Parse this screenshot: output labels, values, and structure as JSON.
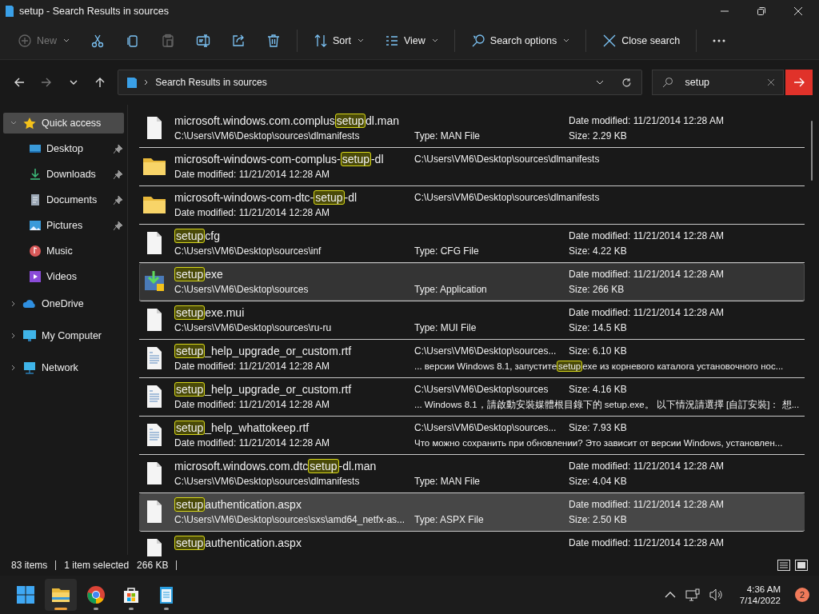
{
  "window": {
    "title": "setup - Search Results in sources"
  },
  "command_bar": [
    {
      "kind": "new",
      "label": "New",
      "disabled": true,
      "dropdown": true
    },
    {
      "kind": "cut",
      "disabled": false,
      "dropdown": false
    },
    {
      "kind": "copy",
      "disabled": false,
      "dropdown": false
    },
    {
      "kind": "paste",
      "disabled": true,
      "dropdown": false
    },
    {
      "kind": "rename",
      "disabled": false,
      "dropdown": false
    },
    {
      "kind": "share",
      "disabled": false,
      "dropdown": false
    },
    {
      "kind": "delete",
      "disabled": false,
      "dropdown": false
    },
    {
      "kind": "sort",
      "label": "Sort",
      "disabled": false,
      "dropdown": true
    },
    {
      "kind": "view",
      "label": "View",
      "disabled": false,
      "dropdown": true
    },
    {
      "kind": "search-options",
      "label": "Search options",
      "disabled": false,
      "dropdown": true
    },
    {
      "kind": "close-search",
      "label": "Close search",
      "disabled": false,
      "dropdown": false
    },
    {
      "kind": "more",
      "disabled": false,
      "dropdown": false
    }
  ],
  "nav_buttons": [
    {
      "kind": "back",
      "disabled": false
    },
    {
      "kind": "forward",
      "disabled": true
    },
    {
      "kind": "recent",
      "disabled": false
    },
    {
      "kind": "up",
      "disabled": false
    }
  ],
  "address": {
    "path": "Search Results in sources"
  },
  "search": {
    "value": "setup"
  },
  "sidebar": {
    "items": [
      {
        "label": "Quick access",
        "kind": "star",
        "expanded": true,
        "selected": true,
        "children": [
          {
            "label": "Desktop",
            "kind": "desktop",
            "pinned": true,
            "selected": false
          },
          {
            "label": "Downloads",
            "kind": "downloads",
            "pinned": true,
            "selected": false
          },
          {
            "label": "Documents",
            "kind": "documents",
            "pinned": true,
            "selected": false
          },
          {
            "label": "Pictures",
            "kind": "pictures",
            "pinned": true,
            "selected": false
          },
          {
            "label": "Music",
            "kind": "music",
            "pinned": false,
            "selected": false
          },
          {
            "label": "Videos",
            "kind": "videos",
            "pinned": false,
            "selected": false
          }
        ]
      },
      {
        "label": "OneDrive",
        "kind": "cloud",
        "expanded": false,
        "selected": false
      },
      {
        "label": "My Computer",
        "kind": "computer",
        "expanded": false,
        "selected": false
      },
      {
        "label": "Network",
        "kind": "network",
        "expanded": false,
        "selected": false
      }
    ]
  },
  "results": [
    {
      "kind": "file",
      "selected": false,
      "hovered": false,
      "name": [
        {
          "text": "microsoft.windows.com.complus",
          "match": false
        },
        {
          "text": "setup",
          "match": true
        },
        {
          "text": "dl.man",
          "match": false
        }
      ],
      "sub": "C:\\Users\\VM6\\Desktop\\sources\\dlmanifests",
      "mid_bottom": "Type: MAN File",
      "right_top": "Date modified: 11/21/2014 12:28 AM",
      "right_bottom": "Size: 2.29 KB"
    },
    {
      "kind": "folder",
      "selected": false,
      "hovered": false,
      "name": [
        {
          "text": "microsoft-windows-com-complus-",
          "match": false
        },
        {
          "text": "setup",
          "match": true
        },
        {
          "text": "-dl",
          "match": false
        }
      ],
      "sub": "Date modified: 11/21/2014 12:28 AM",
      "mid_top": "C:\\Users\\VM6\\Desktop\\sources\\dlmanifests"
    },
    {
      "kind": "folder",
      "selected": false,
      "hovered": false,
      "name": [
        {
          "text": "microsoft-windows-com-dtc-",
          "match": false
        },
        {
          "text": "setup",
          "match": true
        },
        {
          "text": "-dl",
          "match": false
        }
      ],
      "sub": "Date modified: 11/21/2014 12:28 AM",
      "mid_top": "C:\\Users\\VM6\\Desktop\\sources\\dlmanifests"
    },
    {
      "kind": "file",
      "selected": false,
      "hovered": false,
      "name": [
        {
          "text": "setup",
          "match": true
        },
        {
          "text": "cfg",
          "match": false
        }
      ],
      "sub": "C:\\Users\\VM6\\Desktop\\sources\\inf",
      "mid_bottom": "Type: CFG File",
      "right_top": "Date modified: 11/21/2014 12:28 AM",
      "right_bottom": "Size: 4.22 KB"
    },
    {
      "kind": "installer",
      "selected": true,
      "hovered": false,
      "name": [
        {
          "text": "setup",
          "match": true
        },
        {
          "text": "exe",
          "match": false
        }
      ],
      "sub": "C:\\Users\\VM6\\Desktop\\sources",
      "mid_bottom": "Type: Application",
      "right_top": "Date modified: 11/21/2014 12:28 AM",
      "right_bottom": "Size: 266 KB"
    },
    {
      "kind": "file",
      "selected": false,
      "hovered": false,
      "name": [
        {
          "text": "setup",
          "match": true
        },
        {
          "text": "exe.mui",
          "match": false
        }
      ],
      "sub": "C:\\Users\\VM6\\Desktop\\sources\\ru-ru",
      "mid_bottom": "Type: MUI File",
      "right_top": "Date modified: 11/21/2014 12:28 AM",
      "right_bottom": "Size: 14.5 KB"
    },
    {
      "kind": "document",
      "selected": false,
      "hovered": false,
      "name": [
        {
          "text": "setup",
          "match": true
        },
        {
          "text": "_help_upgrade_or_custom.rtf",
          "match": false
        }
      ],
      "sub": "Date modified: 11/21/2014 12:28 AM",
      "mid_top": "C:\\Users\\VM6\\Desktop\\sources...",
      "right_top": "Size: 6.10 KB",
      "snippet": [
        {
          "text": "... версии Windows 8.1, запустите",
          "match": false
        },
        {
          "text": "setup",
          "match": true
        },
        {
          "text": "exe из корневого каталога установочного нос...",
          "match": false
        }
      ]
    },
    {
      "kind": "document",
      "selected": false,
      "hovered": false,
      "name": [
        {
          "text": "setup",
          "match": true
        },
        {
          "text": "_help_upgrade_or_custom.rtf",
          "match": false
        }
      ],
      "sub": "Date modified: 11/21/2014 12:28 AM",
      "mid_top": "C:\\Users\\VM6\\Desktop\\sources",
      "right_top": "Size: 4.16 KB",
      "snippet": [
        {
          "text": "... Windows 8.1，請啟動安裝媒體根目錄下的 setup.exe。 以下情況請選擇 [自訂安裝]： 想...",
          "match": false
        }
      ]
    },
    {
      "kind": "document",
      "selected": false,
      "hovered": false,
      "name": [
        {
          "text": "setup",
          "match": true
        },
        {
          "text": "_help_whattokeep.rtf",
          "match": false
        }
      ],
      "sub": "Date modified: 11/21/2014 12:28 AM",
      "mid_top": "C:\\Users\\VM6\\Desktop\\sources...",
      "right_top": "Size: 7.93 KB",
      "snippet": [
        {
          "text": "Что можно сохранить при обновлении? Это зависит от версии Windows, установлен...",
          "match": false
        }
      ]
    },
    {
      "kind": "file",
      "selected": false,
      "hovered": false,
      "name": [
        {
          "text": "microsoft.windows.com.dtc",
          "match": false
        },
        {
          "text": "setup",
          "match": true
        },
        {
          "text": "-dl.man",
          "match": false
        }
      ],
      "sub": "C:\\Users\\VM6\\Desktop\\sources\\dlmanifests",
      "mid_bottom": "Type: MAN File",
      "right_top": "Date modified: 11/21/2014 12:28 AM",
      "right_bottom": "Size: 4.04 KB"
    },
    {
      "kind": "file",
      "selected": false,
      "hovered": true,
      "name": [
        {
          "text": "setup",
          "match": true
        },
        {
          "text": "authentication.aspx",
          "match": false
        }
      ],
      "sub": "C:\\Users\\VM6\\Desktop\\sources\\sxs\\amd64_netfx-as...",
      "mid_bottom": "Type: ASPX File",
      "right_top": "Date modified: 11/21/2014 12:28 AM",
      "right_bottom": "Size: 2.50 KB"
    },
    {
      "kind": "file",
      "selected": false,
      "hovered": false,
      "name": [
        {
          "text": "setup",
          "match": true
        },
        {
          "text": "authentication.aspx",
          "match": false
        }
      ],
      "right_top": "Date modified: 11/21/2014 12:28 AM"
    }
  ],
  "status_bar": {
    "item_count": "83 items",
    "selection": "1 item selected",
    "selection_size": "266 KB"
  },
  "taskbar": {
    "apps": [
      {
        "kind": "start",
        "running": false,
        "active": false
      },
      {
        "kind": "explorer",
        "running": true,
        "active": true
      },
      {
        "kind": "chrome",
        "running": true,
        "active": false
      },
      {
        "kind": "store",
        "running": true,
        "active": false
      },
      {
        "kind": "notepad",
        "running": true,
        "active": false
      }
    ],
    "time": "4:36 AM",
    "date": "7/14/2022",
    "notification_count": "2"
  }
}
